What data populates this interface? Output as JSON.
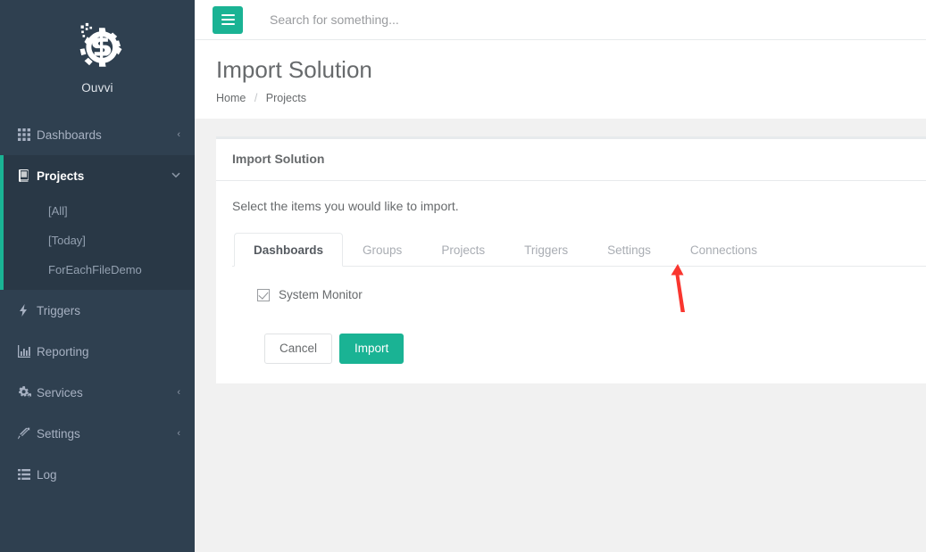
{
  "brand": {
    "name": "Ouvvi",
    "logo_icon": "gear-logo-icon"
  },
  "topbar": {
    "menu_toggle_icon": "hamburger-icon",
    "search_placeholder": "Search for something...",
    "search_value": ""
  },
  "page": {
    "title": "Import Solution",
    "breadcrumb": {
      "home": "Home",
      "separator": "/",
      "current": "Projects"
    }
  },
  "sidebar": {
    "items": [
      {
        "label": "Dashboards",
        "icon": "grid-icon",
        "caret": "‹",
        "expanded": false
      },
      {
        "label": "Projects",
        "icon": "book-icon",
        "caret": "⌵",
        "expanded": true
      },
      {
        "label": "Triggers",
        "icon": "bolt-icon",
        "caret": "",
        "expanded": false
      },
      {
        "label": "Reporting",
        "icon": "bar-chart-icon",
        "caret": "",
        "expanded": false
      },
      {
        "label": "Services",
        "icon": "gears-icon",
        "caret": "‹",
        "expanded": false
      },
      {
        "label": "Settings",
        "icon": "magic-wand-icon",
        "caret": "‹",
        "expanded": false
      },
      {
        "label": "Log",
        "icon": "list-icon",
        "caret": "",
        "expanded": false
      }
    ],
    "projects_subitems": [
      {
        "label": "[All]"
      },
      {
        "label": "[Today]"
      },
      {
        "label": "ForEachFileDemo"
      }
    ]
  },
  "card": {
    "header_title": "Import Solution",
    "intro_text": "Select the items you would like to import.",
    "tabs": [
      {
        "label": "Dashboards",
        "active": true
      },
      {
        "label": "Groups",
        "active": false
      },
      {
        "label": "Projects",
        "active": false
      },
      {
        "label": "Triggers",
        "active": false
      },
      {
        "label": "Settings",
        "active": false
      },
      {
        "label": "Connections",
        "active": false
      }
    ],
    "items": [
      {
        "label": "System Monitor",
        "checked": true
      }
    ],
    "buttons": {
      "cancel": "Cancel",
      "import": "Import"
    }
  },
  "annotation": {
    "arrow_target": "Projects",
    "arrow_color": "#f9362f"
  },
  "colors": {
    "sidebar_bg": "#2f4050",
    "sidebar_active_bg": "#293846",
    "accent": "#1ab394",
    "content_bg": "#f1f1f1",
    "text": "#676a6c",
    "muted": "#a7b1c2"
  }
}
